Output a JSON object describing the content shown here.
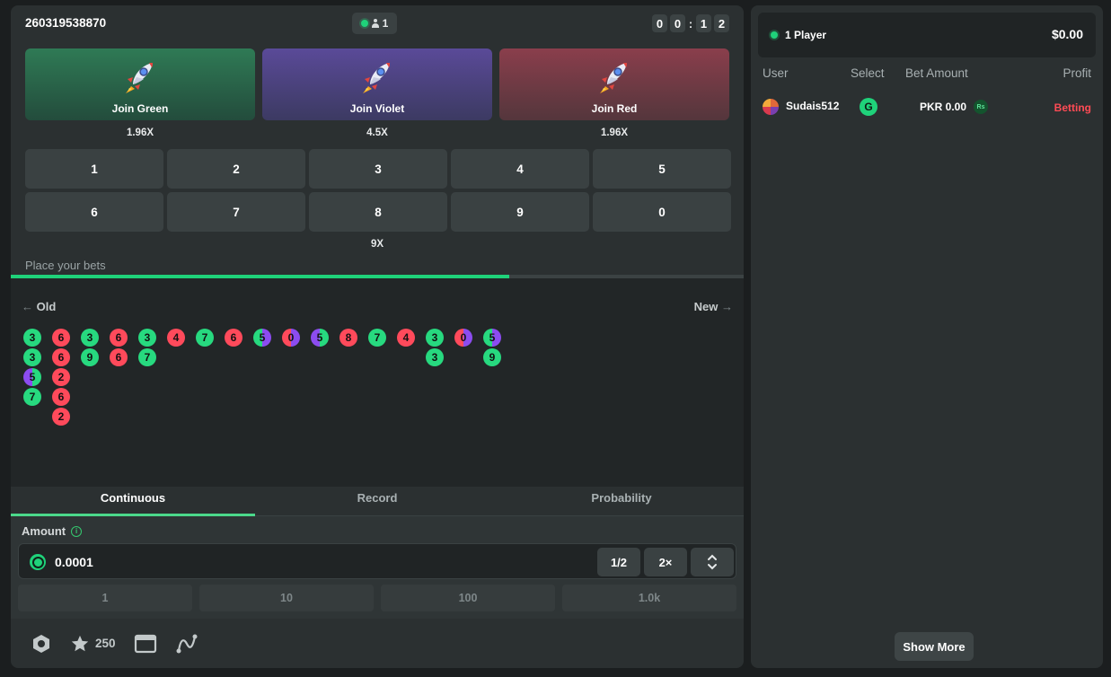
{
  "game": {
    "id": "260319538870",
    "player_count": "1",
    "timer": [
      "0",
      "0",
      "1",
      "2"
    ],
    "timer_separator": ":"
  },
  "join_buttons": [
    {
      "label": "Join Green",
      "multiplier": "1.96X",
      "color": "#2f7a55"
    },
    {
      "label": "Join Violet",
      "multiplier": "4.5X",
      "color": "#5a4a98"
    },
    {
      "label": "Join Red",
      "multiplier": "1.96X",
      "color": "#8a3e4c"
    }
  ],
  "numbers": [
    "1",
    "2",
    "3",
    "4",
    "5",
    "6",
    "7",
    "8",
    "9",
    "0"
  ],
  "number_multiplier": "9X",
  "status_text": "Place your bets",
  "round_progress": 0.68,
  "history": {
    "old_label": "Old",
    "new_label": "New",
    "columns": [
      [
        {
          "n": "3",
          "c": "green"
        },
        {
          "n": "3",
          "c": "green"
        },
        {
          "n": "5",
          "c": "violet-green"
        },
        {
          "n": "7",
          "c": "green"
        }
      ],
      [
        {
          "n": "6",
          "c": "red"
        },
        {
          "n": "6",
          "c": "red"
        },
        {
          "n": "2",
          "c": "red"
        },
        {
          "n": "6",
          "c": "red"
        },
        {
          "n": "2",
          "c": "red"
        }
      ],
      [
        {
          "n": "3",
          "c": "green"
        },
        {
          "n": "9",
          "c": "green"
        }
      ],
      [
        {
          "n": "6",
          "c": "red"
        },
        {
          "n": "6",
          "c": "red"
        }
      ],
      [
        {
          "n": "3",
          "c": "green"
        },
        {
          "n": "7",
          "c": "green"
        }
      ],
      [
        {
          "n": "4",
          "c": "red"
        }
      ],
      [
        {
          "n": "7",
          "c": "green"
        }
      ],
      [
        {
          "n": "6",
          "c": "red"
        }
      ],
      [
        {
          "n": "5",
          "c": "green-violet"
        }
      ],
      [
        {
          "n": "0",
          "c": "red-violet"
        }
      ],
      [
        {
          "n": "5",
          "c": "violet-green"
        }
      ],
      [
        {
          "n": "8",
          "c": "red"
        }
      ],
      [
        {
          "n": "7",
          "c": "green"
        }
      ],
      [
        {
          "n": "4",
          "c": "red"
        }
      ],
      [
        {
          "n": "3",
          "c": "green"
        },
        {
          "n": "3",
          "c": "green"
        }
      ],
      [
        {
          "n": "0",
          "c": "red-violet"
        }
      ],
      [
        {
          "n": "5",
          "c": "green-violet"
        },
        {
          "n": "9",
          "c": "green"
        }
      ]
    ],
    "colors": {
      "green": "#27d97f",
      "red": "#ff4a5b",
      "violet": "#8c4cf0"
    }
  },
  "tabs": [
    "Continuous",
    "Record",
    "Probability"
  ],
  "active_tab": 0,
  "amount": {
    "label": "Amount",
    "value": "0.0001",
    "half_label": "1/2",
    "double_label": "2×"
  },
  "quick_amounts": [
    "1",
    "10",
    "100",
    "1.0k"
  ],
  "footer": {
    "star_count": "250"
  },
  "sidebar": {
    "players_label": "1 Player",
    "total": "$0.00",
    "headers": [
      "User",
      "Select",
      "Bet Amount",
      "Profit"
    ],
    "rows": [
      {
        "user": "Sudais512",
        "select": "G",
        "bet": "PKR 0.00",
        "currency_badge": "Rs",
        "profit": "Betting"
      }
    ],
    "show_more": "Show More"
  }
}
